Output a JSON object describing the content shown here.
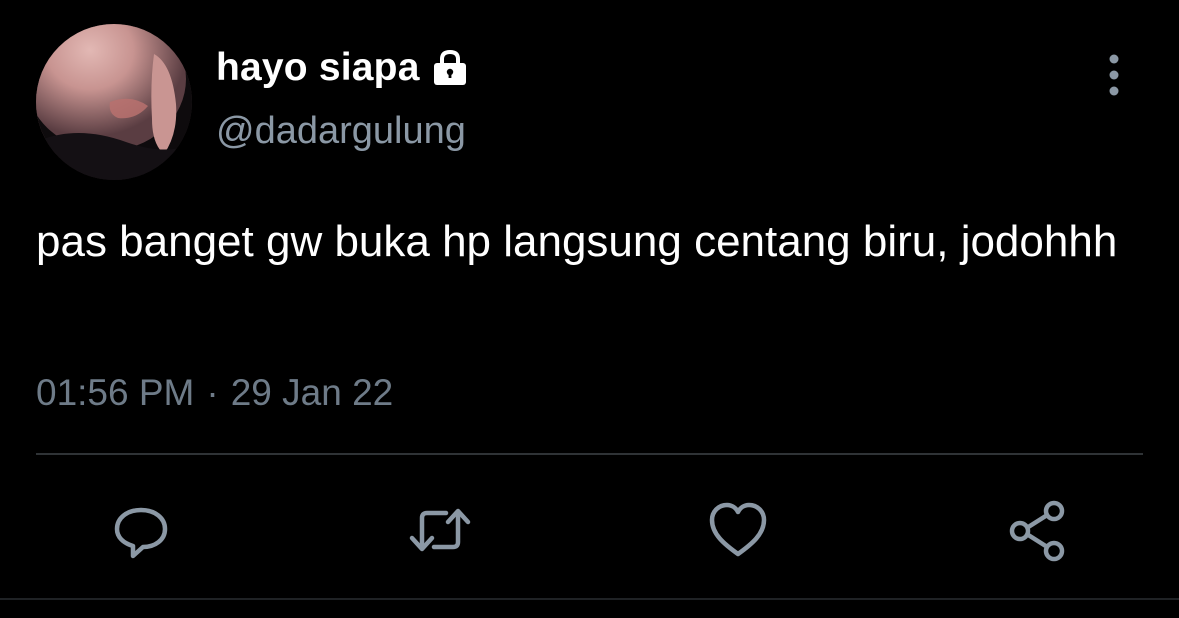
{
  "tweet": {
    "display_name": "hayo siapa",
    "handle": "@dadargulung",
    "protected_icon": "lock-icon",
    "text": "pas banget gw buka hp langsung centang biru, jodohhh",
    "time": "01:56 PM",
    "separator": "·",
    "date": "29 Jan 22"
  },
  "actions": {
    "reply_icon": "speech-bubble-icon",
    "retweet_icon": "retweet-arrows-icon",
    "like_icon": "heart-icon",
    "share_icon": "share-nodes-icon",
    "more_icon": "vertical-ellipsis-icon"
  },
  "colors": {
    "background": "#000000",
    "primary_text": "#ffffff",
    "secondary_text": "#8b98a5",
    "timestamp_text": "#6e7b88",
    "icon": "#8b98a5",
    "divider": "#2f3336"
  }
}
